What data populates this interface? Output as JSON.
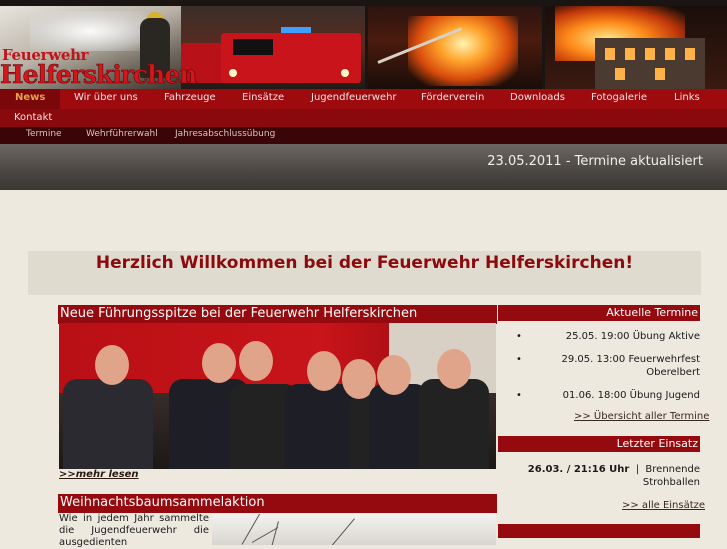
{
  "header": {
    "logo_line1": "Feuerwehr",
    "logo_line2": "Helferskirchen"
  },
  "nav": {
    "items": [
      {
        "label": "News",
        "active": true
      },
      {
        "label": "Wir über uns"
      },
      {
        "label": "Fahrzeuge"
      },
      {
        "label": "Einsätze"
      },
      {
        "label": "Jugendfeuerwehr"
      },
      {
        "label": "Förderverein"
      },
      {
        "label": "Downloads"
      },
      {
        "label": "Fotogalerie"
      },
      {
        "label": "Links"
      },
      {
        "label": "Kontakt"
      }
    ],
    "subitems": [
      {
        "label": "Termine"
      },
      {
        "label": "Wehrführerwahl"
      },
      {
        "label": "Jahresabschlussübung"
      }
    ]
  },
  "ticker": {
    "text": "23.05.2011 - Termine aktualisiert"
  },
  "welcome": {
    "title": "Herzlich Willkommen bei der Feuerwehr Helferskirchen!"
  },
  "articles": [
    {
      "title": "Neue Führungsspitze bei der Feuerwehr Helferskirchen",
      "more": ">>mehr lesen"
    },
    {
      "title": "Weihnachtsbaumsammelaktion",
      "excerpt": "Wie in jedem Jahr sammelte die Jugendfeuerwehr die ausgedienten"
    }
  ],
  "sidebar": {
    "termine_title": "Aktuelle Termine",
    "termine": [
      {
        "line1": "25.05.  19:00  Übung Aktive",
        "line2": ""
      },
      {
        "line1": "29.05.  13:00  Feuerwehrfest",
        "line2": "Oberelbert"
      },
      {
        "line1": "01.06.  18:00  Übung Jugend",
        "line2": ""
      }
    ],
    "termine_link": ">> Übersicht aller Termine",
    "einsatz_title": "Letzter Einsatz",
    "einsatz_date": "26.03. / 21:16 Uhr",
    "einsatz_sep": "|",
    "einsatz_line1": "Brennende",
    "einsatz_line2": "Strohballen",
    "einsatz_link": ">> alle Einsätze"
  },
  "colors": {
    "accent": "#940a0e",
    "nav": "#9e0b0f",
    "background": "#ede9df"
  }
}
